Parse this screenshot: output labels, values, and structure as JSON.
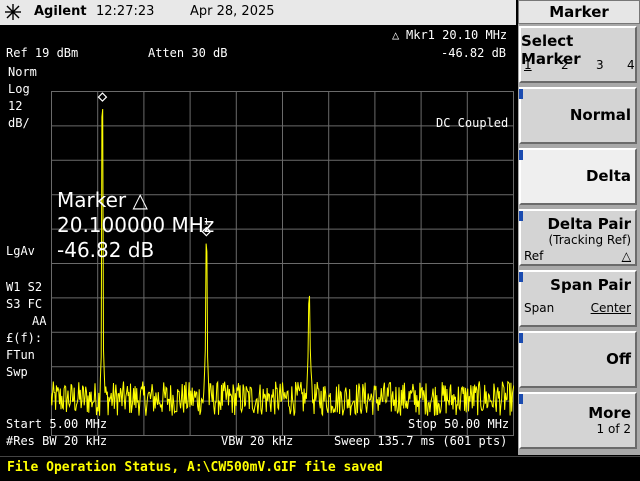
{
  "title_bar": {
    "brand": "Agilent",
    "time": "12:27:23",
    "date": "Apr 28, 2025"
  },
  "header": {
    "marker_readout": "Mkr1  20.10 MHz",
    "ref_level": "Ref 19 dBm",
    "atten": "Atten 30 dB",
    "marker_value": "-46.82 dB"
  },
  "left_annotations": {
    "norm": "Norm",
    "log": "Log",
    "scale": "12",
    "units": "dB/",
    "avg": "LgAv",
    "w1s2": "W1  S2",
    "s3fc": "S3  FC",
    "aa": "AA",
    "ff": "£(f):",
    "ftun": "FTun",
    "swp": "Swp"
  },
  "coupling": "DC Coupled",
  "marker_box": {
    "title": "Marker △",
    "freq": "20.100000 MHz",
    "delta": "-46.82 dB"
  },
  "markers": {
    "ref_label": "1R",
    "delta_label": "1"
  },
  "footer": {
    "start": "Start 5.00 MHz",
    "stop": "Stop 50.00 MHz",
    "rbw": "#Res BW 20 kHz",
    "vbw": "VBW 20 kHz",
    "sweep": "Sweep 135.7 ms (601 pts)"
  },
  "status": "File Operation Status, A:\\CW500mV.GIF file saved",
  "softkeys": {
    "title": "Marker",
    "select_marker": {
      "label": "Select Marker",
      "options": [
        "1",
        "2",
        "3",
        "4"
      ]
    },
    "normal": "Normal",
    "delta": "Delta",
    "delta_pair": {
      "label": "Delta Pair",
      "sub": "(Tracking Ref)",
      "left": "Ref",
      "right": "△"
    },
    "span_pair": {
      "label": "Span Pair",
      "left": "Span",
      "right": "Center"
    },
    "off": "Off",
    "more": {
      "label": "More",
      "sub": "1 of 2"
    }
  },
  "colors": {
    "trace": "#ffff00",
    "grid": "#6a6a6a",
    "status_text": "#ffff00"
  },
  "trace": {
    "start_mhz": 5.0,
    "stop_mhz": 50.0,
    "ref_dbm": 19,
    "db_per_div": 12,
    "noise_floor_dbm": -88,
    "peaks": [
      {
        "freq_mhz": 10.0,
        "level_dbm": 15.5
      },
      {
        "freq_mhz": 20.1,
        "level_dbm": -31.3
      },
      {
        "freq_mhz": 30.1,
        "level_dbm": -49.5
      }
    ]
  }
}
